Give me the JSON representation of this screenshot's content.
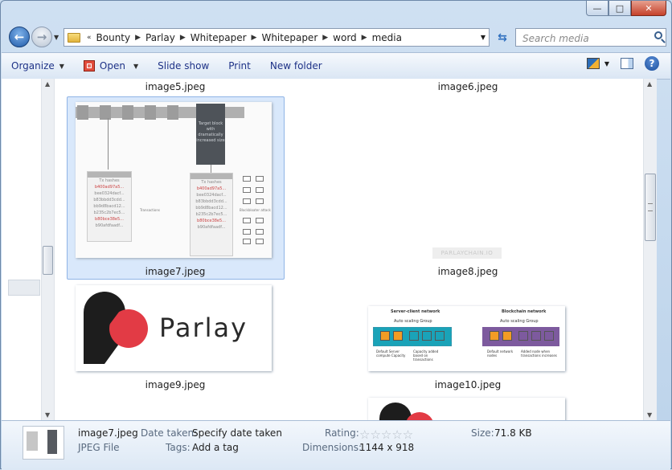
{
  "window": {
    "buttons": {
      "minimize": "—",
      "maximize": "□",
      "close": "✕"
    }
  },
  "address": {
    "overflow": "«",
    "crumbs": [
      "Bounty",
      "Parlay",
      "Whitepaper",
      "Whitepaper",
      "word",
      "media"
    ],
    "search_placeholder": "Search media"
  },
  "toolbar": {
    "organize": "Organize",
    "open": "Open",
    "slideshow": "Slide show",
    "print": "Print",
    "new_folder": "New folder",
    "help": "?"
  },
  "files": {
    "image5": "image5.jpeg",
    "image6": "image6.jpeg",
    "image7": "image7.jpeg",
    "image8": "image8.jpeg",
    "image9": "image9.jpeg",
    "image10": "image10.jpeg"
  },
  "thumb7": {
    "target_block": "Target block with dramatically increased size",
    "header_left": "Tx hashes",
    "header_right": "Tx hashes",
    "hashes_left": [
      "b400ad97a5...",
      "bee0324dacf...",
      "b83bbdd3cdd...",
      "bb9d8bacd12...",
      "b235c2b7ec5...",
      "b80bce38e5...",
      "b90afdfaadf..."
    ],
    "hashes_right": [
      "b400ad97a5...",
      "bee0324dacf...",
      "b83bbdd3cdd...",
      "bb9d8bacd12...",
      "b235c2b7ec5...",
      "b80bce38e5...",
      "b90afdfaadf..."
    ],
    "transactions_label": "Transactions",
    "attack_label": "Blockbloater attack"
  },
  "thumb8": {
    "watermark": "PARLAYCHAIN.IO"
  },
  "thumb9": {
    "brand": "Parlay"
  },
  "thumb10": {
    "left_title": "Server-client network",
    "left_group": "Auto scaling Group",
    "left_cap1": "Default Server compute Capacity",
    "left_cap2": "Capacity added based on transactions",
    "right_title": "Blockchain network",
    "right_group": "Auto scaling Group",
    "right_cap1": "Default network nodes",
    "right_cap2": "Added node when transactions increases",
    "colors": {
      "teal": "#1aa3b8",
      "orange": "#f39c24",
      "purple": "#7d5a9e",
      "dark": "#1d1d1d",
      "red": "#e23b45"
    }
  },
  "details": {
    "filename": "image7.jpeg",
    "filetype": "JPEG File",
    "date_taken_label": "Date taken:",
    "date_taken_value": "Specify date taken",
    "tags_label": "Tags:",
    "tags_value": "Add a tag",
    "rating_label": "Rating:",
    "rating_stars": "☆☆☆☆☆",
    "dimensions_label": "Dimensions:",
    "dimensions_value": "1144 x 918",
    "size_label": "Size:",
    "size_value": "71.8 KB"
  }
}
